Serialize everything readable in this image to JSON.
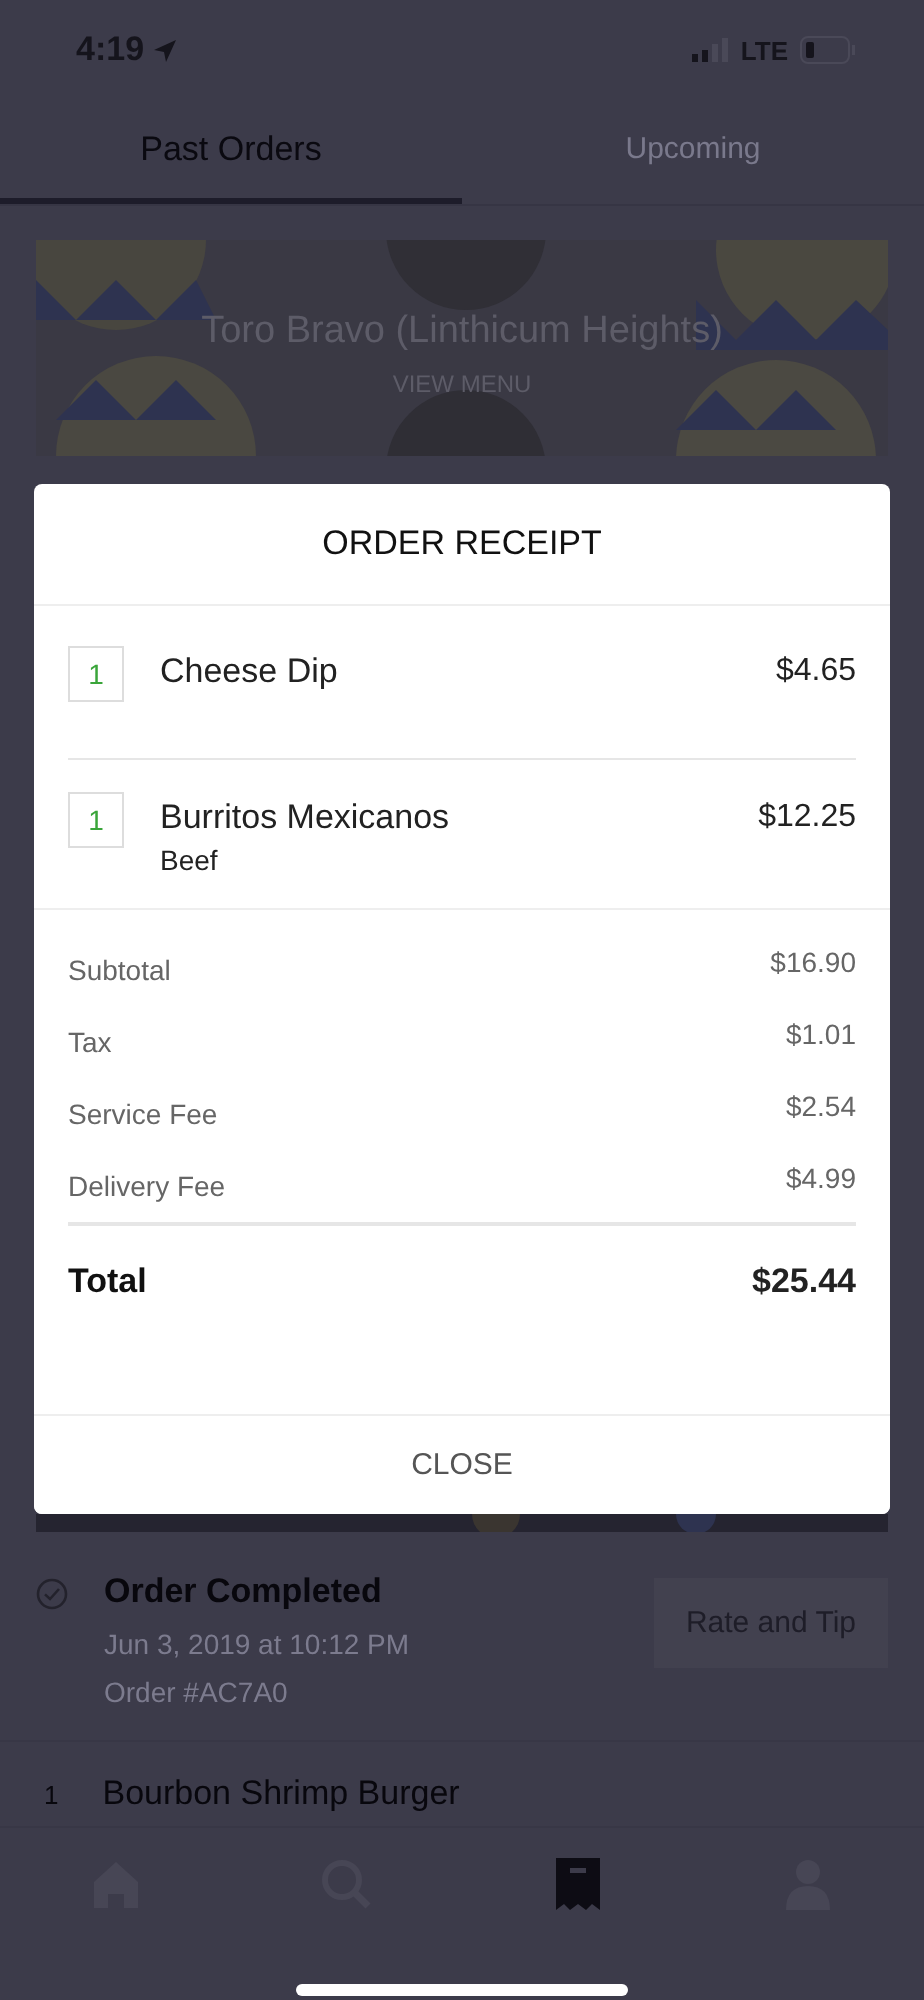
{
  "status_bar": {
    "time": "4:19",
    "network": "LTE"
  },
  "tabs": [
    {
      "label": "Past Orders",
      "selected": true
    },
    {
      "label": "Upcoming",
      "selected": false
    }
  ],
  "restaurant": {
    "name": "Toro Bravo (Linthicum Heights)",
    "action": "VIEW MENU"
  },
  "receipt": {
    "title": "ORDER RECEIPT",
    "items": [
      {
        "quantity": "1",
        "name": "Cheese Dip",
        "price": "$4.65"
      },
      {
        "quantity": "1",
        "name": "Burritos Mexicanos",
        "detail": "Beef",
        "price": "$12.25"
      }
    ],
    "charges": [
      {
        "label": "Subtotal",
        "amount": "$16.90"
      },
      {
        "label": "Tax",
        "amount": "$1.01"
      },
      {
        "label": "Service Fee",
        "amount": "$2.54"
      },
      {
        "label": "Delivery Fee",
        "amount": "$4.99"
      }
    ],
    "total": {
      "label": "Total",
      "amount": "$25.44"
    },
    "close": "CLOSE"
  },
  "order": {
    "status": "Order Completed",
    "date": "Jun 3, 2019 at 10:12 PM",
    "number": "Order #AC7A0",
    "action": "Rate and Tip",
    "items": [
      {
        "quantity": "1",
        "name": "Bourbon Shrimp Burger"
      }
    ]
  },
  "nav": [
    {
      "kind": "home",
      "selected": false
    },
    {
      "kind": "search",
      "selected": false
    },
    {
      "kind": "orders",
      "selected": true
    },
    {
      "kind": "account",
      "selected": false
    }
  ]
}
